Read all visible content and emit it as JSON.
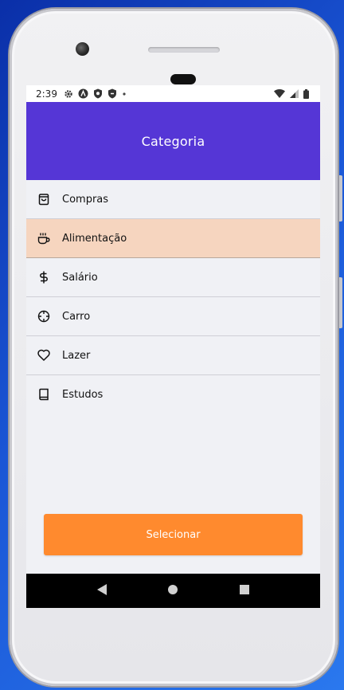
{
  "status_bar": {
    "time": "2:39",
    "left_icons": [
      "gear-icon",
      "vpn-a-icon",
      "shield-icon",
      "shield-icon",
      "dot-icon"
    ],
    "right_icons": [
      "wifi-icon",
      "cell-signal-icon",
      "battery-icon"
    ]
  },
  "header": {
    "title": "Categoria",
    "color": "#5536d6"
  },
  "categories": [
    {
      "label": "Compras",
      "icon": "shopping-bag-icon",
      "selected": false
    },
    {
      "label": "Alimentação",
      "icon": "coffee-icon",
      "selected": true
    },
    {
      "label": "Salário",
      "icon": "dollar-icon",
      "selected": false
    },
    {
      "label": "Carro",
      "icon": "crosshair-icon",
      "selected": false
    },
    {
      "label": "Lazer",
      "icon": "heart-icon",
      "selected": false
    },
    {
      "label": "Estudos",
      "icon": "book-icon",
      "selected": false
    }
  ],
  "select_button": {
    "label": "Selecionar",
    "color": "#ff8a2e"
  },
  "selected_row_color": "#f6d5bf",
  "nav_bar": [
    "back-icon",
    "home-icon",
    "recents-icon"
  ]
}
